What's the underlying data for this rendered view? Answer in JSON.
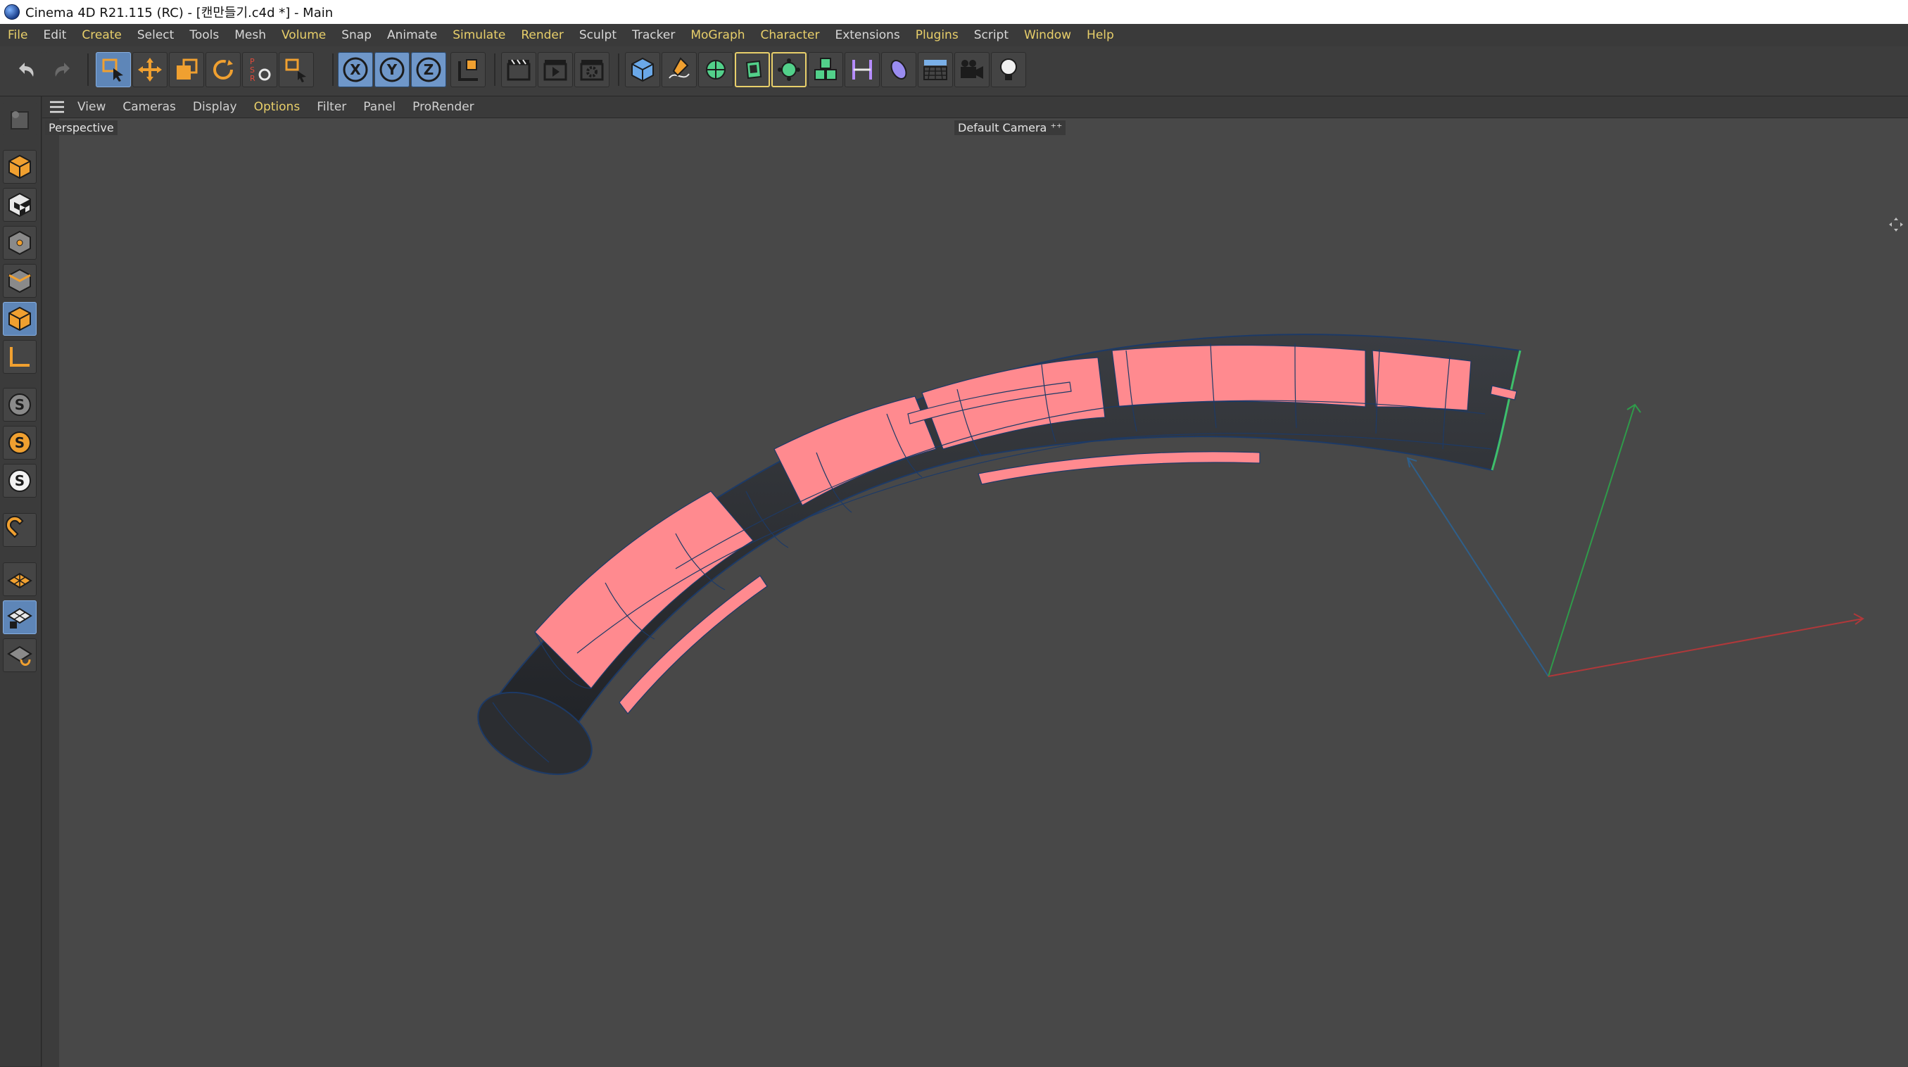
{
  "window": {
    "title": "Cinema 4D R21.115 (RC) - [캔만들기.c4d *] - Main"
  },
  "menu": [
    {
      "label": "File",
      "hl": true
    },
    {
      "label": "Edit",
      "hl": false
    },
    {
      "label": "Create",
      "hl": true
    },
    {
      "label": "Select",
      "hl": false
    },
    {
      "label": "Tools",
      "hl": false
    },
    {
      "label": "Mesh",
      "hl": false
    },
    {
      "label": "Volume",
      "hl": true
    },
    {
      "label": "Snap",
      "hl": false
    },
    {
      "label": "Animate",
      "hl": false
    },
    {
      "label": "Simulate",
      "hl": true
    },
    {
      "label": "Render",
      "hl": true
    },
    {
      "label": "Sculpt",
      "hl": false
    },
    {
      "label": "Tracker",
      "hl": false
    },
    {
      "label": "MoGraph",
      "hl": true
    },
    {
      "label": "Character",
      "hl": true
    },
    {
      "label": "Extensions",
      "hl": false
    },
    {
      "label": "Plugins",
      "hl": true
    },
    {
      "label": "Script",
      "hl": false
    },
    {
      "label": "Window",
      "hl": true
    },
    {
      "label": "Help",
      "hl": true
    }
  ],
  "toolbar": {
    "undo": "undo-icon",
    "redo": "redo-icon",
    "axis_x": "X",
    "axis_y": "Y",
    "axis_z": "Z",
    "psr_letters": [
      "P",
      "S",
      "R"
    ]
  },
  "viewport_menu": [
    {
      "label": "View",
      "hl": false
    },
    {
      "label": "Cameras",
      "hl": false
    },
    {
      "label": "Display",
      "hl": false
    },
    {
      "label": "Options",
      "hl": true
    },
    {
      "label": "Filter",
      "hl": false
    },
    {
      "label": "Panel",
      "hl": false
    },
    {
      "label": "ProRender",
      "hl": false
    }
  ],
  "viewport": {
    "projection": "Perspective",
    "camera": "Default Camera",
    "background": "#484848"
  },
  "palette": {
    "snap_letter": "S"
  },
  "colors": {
    "selection": "#ff8a8f",
    "mesh": "#2a2c30",
    "wire": "#1d3a66",
    "axis_x": "#b0383a",
    "axis_y": "#2f9a4a",
    "axis_z": "#2f5f8a",
    "menu_highlight": "#e8cf6a",
    "active_tool": "#5e86b8"
  }
}
